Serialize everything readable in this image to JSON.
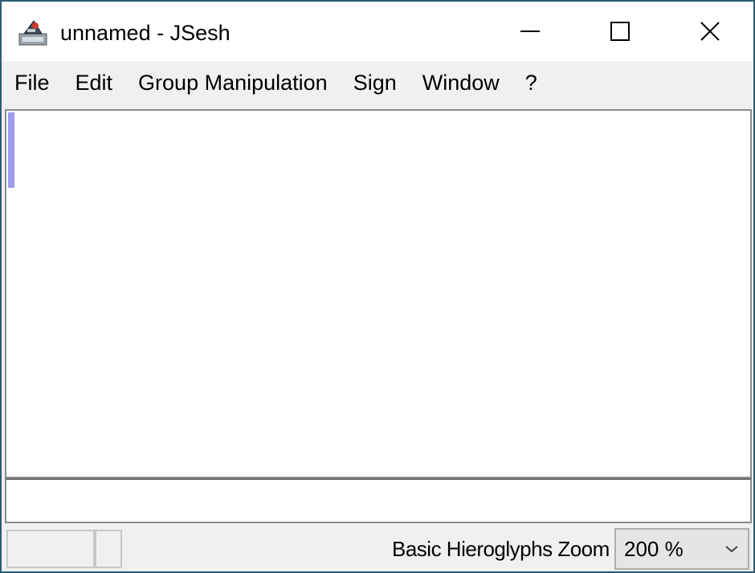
{
  "window": {
    "title": "unnamed - JSesh",
    "icon": "jsesh-app-icon"
  },
  "menu": {
    "items": [
      {
        "label": "File"
      },
      {
        "label": "Edit"
      },
      {
        "label": "Group Manipulation"
      },
      {
        "label": "Sign"
      },
      {
        "label": "Window"
      },
      {
        "label": "?"
      }
    ]
  },
  "statusbar": {
    "font_label": "Basic Hieroglyphs Zoom",
    "zoom": {
      "selected": "200 %"
    }
  },
  "colors": {
    "border": "#2b5a79",
    "caret": "#9c9cf2",
    "background": "#f0f0f0"
  }
}
